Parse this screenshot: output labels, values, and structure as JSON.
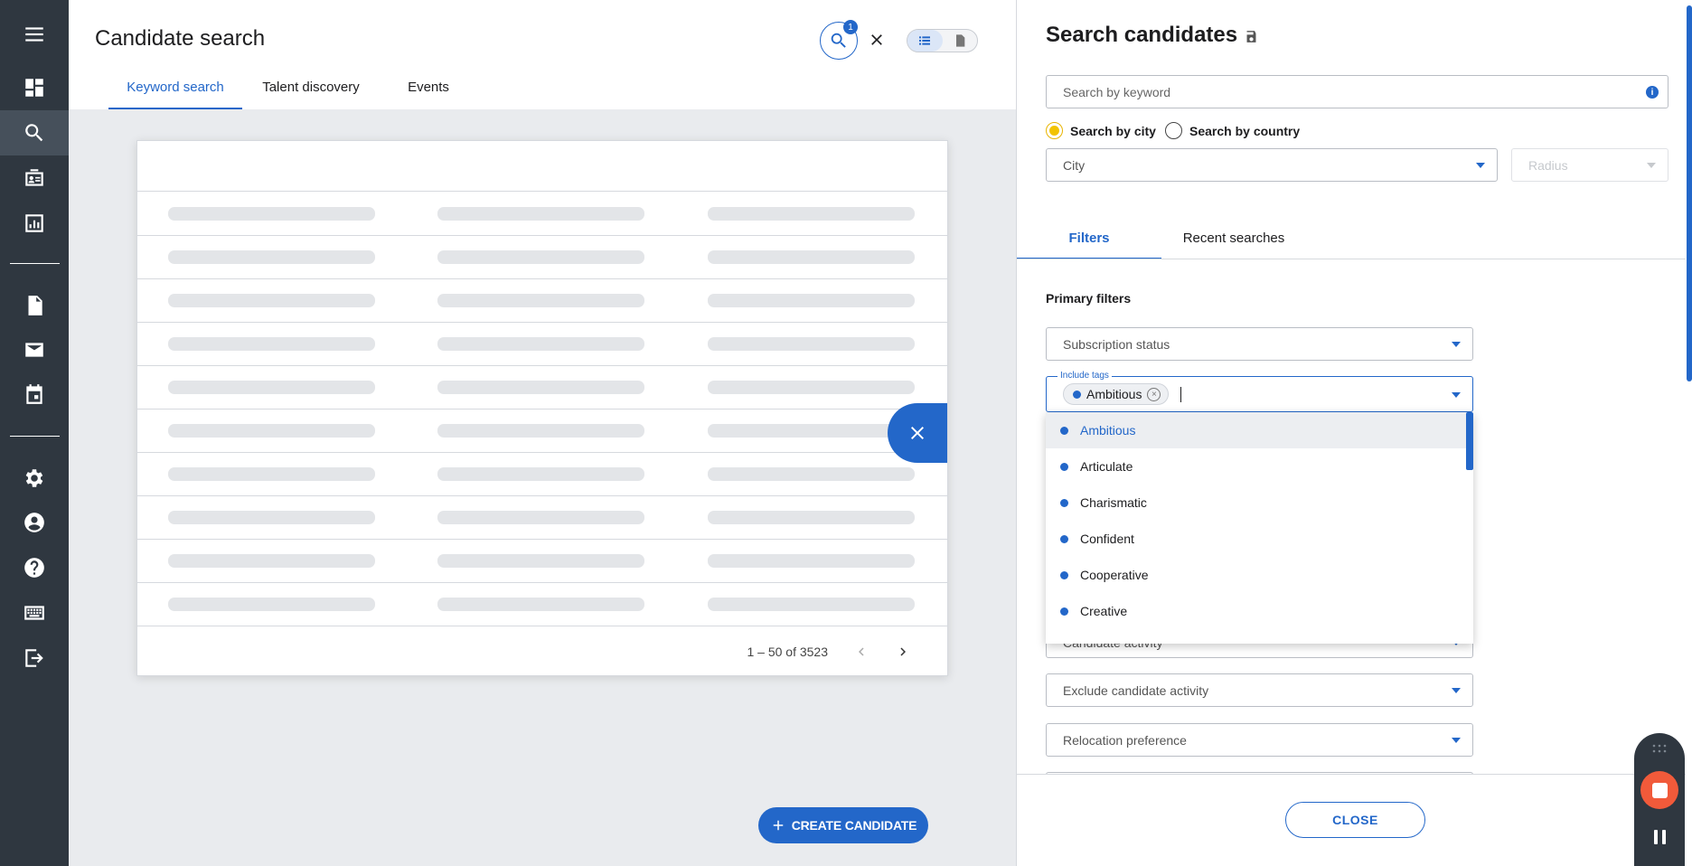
{
  "left_nav": {
    "items": [
      {
        "icon": "menu-icon"
      },
      {
        "icon": "dashboard-icon"
      },
      {
        "icon": "search-icon",
        "active": true
      },
      {
        "icon": "contacts-icon"
      },
      {
        "icon": "reports-icon"
      },
      {
        "icon": "document-icon"
      },
      {
        "icon": "mail-icon"
      },
      {
        "icon": "calendar-icon"
      },
      {
        "icon": "gear-icon"
      },
      {
        "icon": "account-icon"
      },
      {
        "icon": "help-icon"
      },
      {
        "icon": "keyboard-icon"
      },
      {
        "icon": "logout-icon"
      }
    ]
  },
  "header": {
    "title": "Candidate search",
    "tabs": [
      {
        "label": "Keyword search",
        "active": true
      },
      {
        "label": "Talent discovery",
        "active": false
      },
      {
        "label": "Events",
        "active": false
      }
    ],
    "search_badge_count": "1"
  },
  "table": {
    "pagination": {
      "range_text": "1 – 50 of 3523"
    }
  },
  "create_button": {
    "label": "CREATE CANDIDATE"
  },
  "panel": {
    "title": "Search candidates",
    "keyword_placeholder": "Search by keyword",
    "info_glyph": "i",
    "location_mode": {
      "options": [
        {
          "label": "Search by city",
          "selected": true
        },
        {
          "label": "Search by country",
          "selected": false
        }
      ]
    },
    "city_select": {
      "value": "City"
    },
    "radius_select": {
      "value": "Radius",
      "disabled": true
    },
    "tabs": [
      {
        "label": "Filters",
        "active": true
      },
      {
        "label": "Recent searches",
        "active": false
      }
    ],
    "primary_filters_label": "Primary filters",
    "subscription_status": {
      "value": "Subscription status"
    },
    "include_tags": {
      "legend": "Include tags",
      "chips": [
        {
          "label": "Ambitious"
        }
      ],
      "chip_remove_glyph": "×"
    },
    "tag_options": [
      {
        "label": "Ambitious",
        "selected": true
      },
      {
        "label": "Articulate",
        "selected": false
      },
      {
        "label": "Charismatic",
        "selected": false
      },
      {
        "label": "Confident",
        "selected": false
      },
      {
        "label": "Cooperative",
        "selected": false
      },
      {
        "label": "Creative",
        "selected": false
      }
    ],
    "candidate_activity": {
      "value": "Candidate activity"
    },
    "exclude_candidate_activity": {
      "value": "Exclude candidate activity"
    },
    "relocation_preference": {
      "value": "Relocation preference"
    },
    "close_button": "CLOSE"
  },
  "colors": {
    "accent": "#2367c9",
    "sidebar": "#2f3740",
    "radio_selected": "#f2c300",
    "record_stop": "#f15a3a"
  }
}
